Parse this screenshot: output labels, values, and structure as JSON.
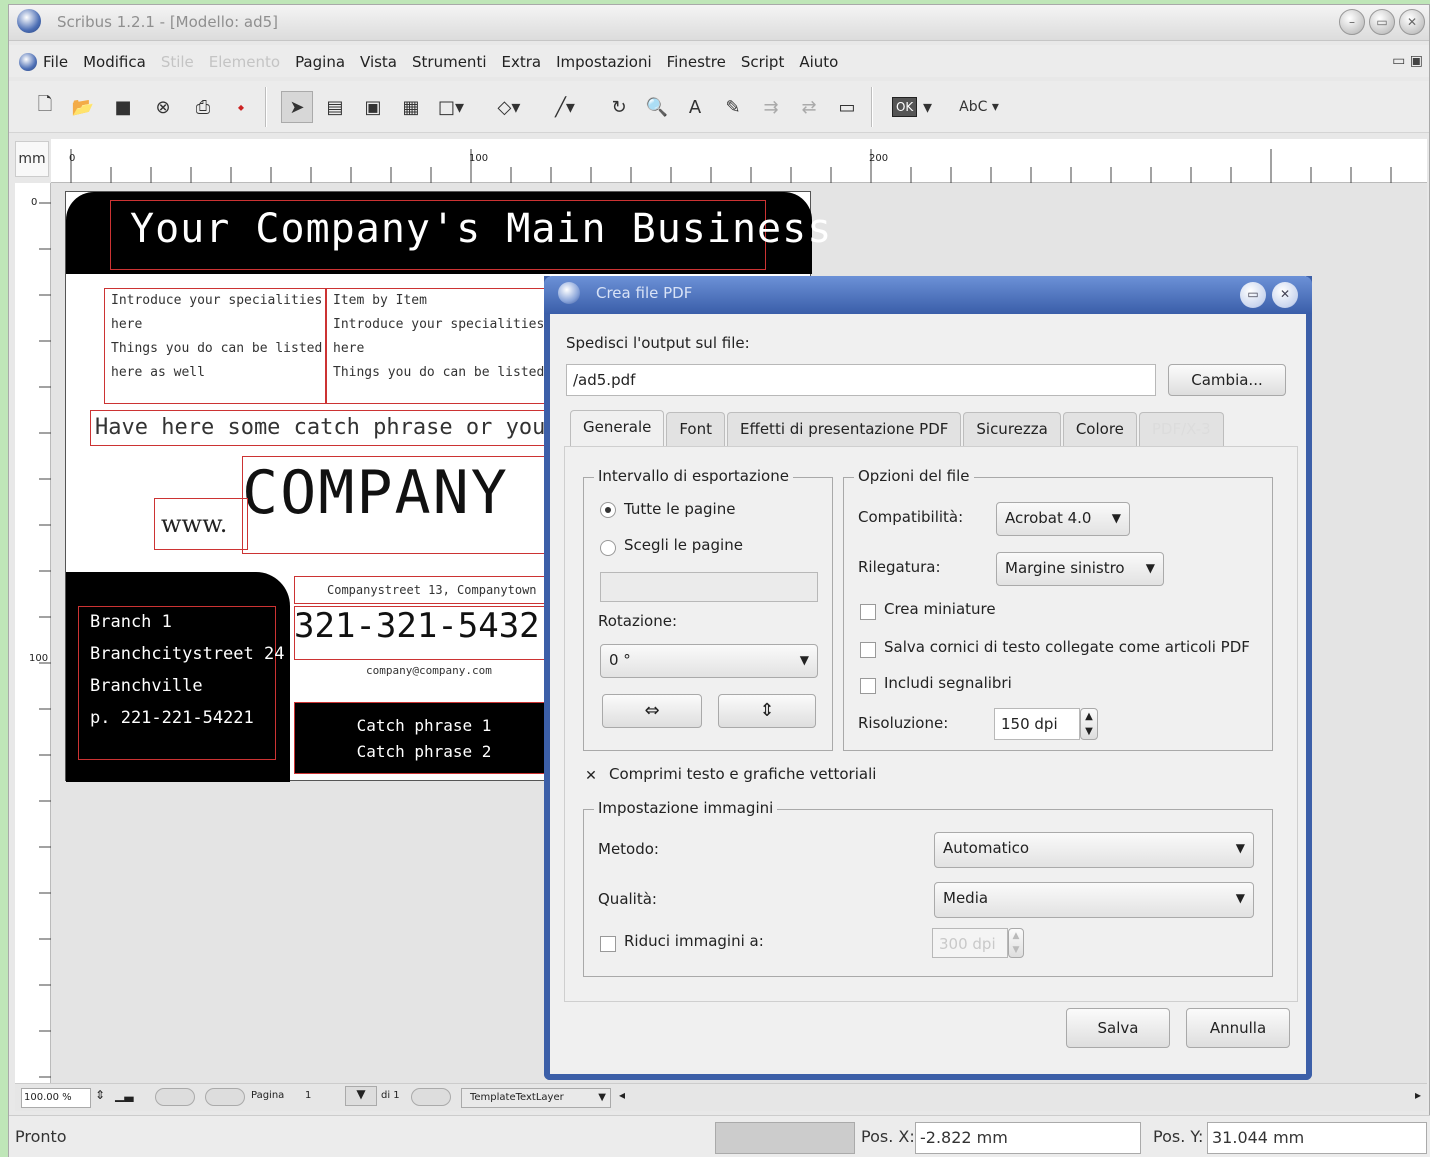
{
  "window": {
    "title": "Scribus 1.2.1 - [Modello: ad5]",
    "menu": [
      {
        "label": "File",
        "disabled": false
      },
      {
        "label": "Modifica",
        "disabled": false
      },
      {
        "label": "Stile",
        "disabled": true
      },
      {
        "label": "Elemento",
        "disabled": true
      },
      {
        "label": "Pagina",
        "disabled": false
      },
      {
        "label": "Vista",
        "disabled": false
      },
      {
        "label": "Strumenti",
        "disabled": false
      },
      {
        "label": "Extra",
        "disabled": false
      },
      {
        "label": "Impostazioni",
        "disabled": false
      },
      {
        "label": "Finestre",
        "disabled": false
      },
      {
        "label": "Script",
        "disabled": false
      },
      {
        "label": "Aiuto",
        "disabled": false
      }
    ]
  },
  "toolbar": {
    "icons": [
      "new-document-icon",
      "open-folder-icon",
      "save-icon",
      "close-icon",
      "print-icon",
      "pdf-icon",
      "select-arrow-icon",
      "text-frame-icon",
      "image-frame-icon",
      "table-icon",
      "rectangle-icon",
      "polygon-icon",
      "line-icon",
      "rotate-icon",
      "zoom-icon",
      "edit-text-icon",
      "link-icon",
      "unlink-icon",
      "measure-icon",
      "eyedropper-icon",
      "ok-icon",
      "spell-check-icon"
    ],
    "ok_label": "OK",
    "spell_label": "AbC"
  },
  "ruler": {
    "unit": "mm",
    "h_marks": [
      "0",
      "100",
      "200"
    ],
    "v_marks": [
      "0",
      "100"
    ]
  },
  "card": {
    "headline": "Your Company's Main Business",
    "specialties_left": [
      "Introduce your specialities",
      "here",
      "Things you do can be listed",
      "here as well"
    ],
    "specialties_right": [
      "Item by Item",
      "Introduce your specialities",
      "here",
      "Things you do can be listed"
    ],
    "catch_phrase_line": "Have here some catch phrase or your",
    "www": "www.",
    "company": "COMPANY",
    "company_street": "Companystreet 13, Companytown",
    "phone": "321-321-5432",
    "email": "company@company.com",
    "branch": [
      "Branch 1",
      "Branchcitystreet 24",
      "Branchville",
      "p. 221-221-54221"
    ],
    "catch_phrases": [
      "Catch phrase 1",
      "Catch phrase 2"
    ]
  },
  "bottom_bar": {
    "zoom": "100.00 %",
    "page_label": "Pagina",
    "page_value": "1",
    "of_label": "di 1",
    "layer": "TemplateTextLayer"
  },
  "status": {
    "text": "Pronto",
    "pos_x_label": "Pos. X:",
    "pos_x_value": "-2.822 mm",
    "pos_y_label": "Pos. Y:",
    "pos_y_value": "31.044 mm"
  },
  "dialog": {
    "title": "Crea file PDF",
    "output_label": "Spedisci l'output sul file:",
    "output_value": "/ad5.pdf",
    "change_button": "Cambia...",
    "tabs": [
      {
        "label": "Generale",
        "active": true,
        "disabled": false
      },
      {
        "label": "Font",
        "active": false,
        "disabled": false
      },
      {
        "label": "Effetti di presentazione PDF",
        "active": false,
        "disabled": false
      },
      {
        "label": "Sicurezza",
        "active": false,
        "disabled": false
      },
      {
        "label": "Colore",
        "active": false,
        "disabled": false
      },
      {
        "label": "PDF/X-3",
        "active": false,
        "disabled": true
      }
    ],
    "export_range": {
      "title": "Intervallo di esportazione",
      "all_pages": "Tutte le pagine",
      "choose_pages": "Scegli le pagine",
      "selected": "all_pages",
      "rotation_label": "Rotazione:",
      "rotation_value": "0 °"
    },
    "file_options": {
      "title": "Opzioni del file",
      "compat_label": "Compatibilità:",
      "compat_value": "Acrobat 4.0",
      "binding_label": "Rilegatura:",
      "binding_value": "Margine sinistro",
      "thumbnails_label": "Crea miniature",
      "thumbnails_checked": false,
      "save_linked_label": "Salva cornici di testo collegate come articoli PDF",
      "save_linked_checked": false,
      "bookmarks_label": "Includi segnalibri",
      "bookmarks_checked": false,
      "resolution_label": "Risoluzione:",
      "resolution_value": "150 dpi"
    },
    "compress_label": "Comprimi testo e grafiche vettoriali",
    "compress_checked": true,
    "image_settings": {
      "title": "Impostazione immagini",
      "method_label": "Metodo:",
      "method_value": "Automatico",
      "quality_label": "Qualità:",
      "quality_value": "Media",
      "downsample_label": "Riduci immagini a:",
      "downsample_checked": false,
      "downsample_value": "300 dpi"
    },
    "save_button": "Salva",
    "cancel_button": "Annulla"
  }
}
